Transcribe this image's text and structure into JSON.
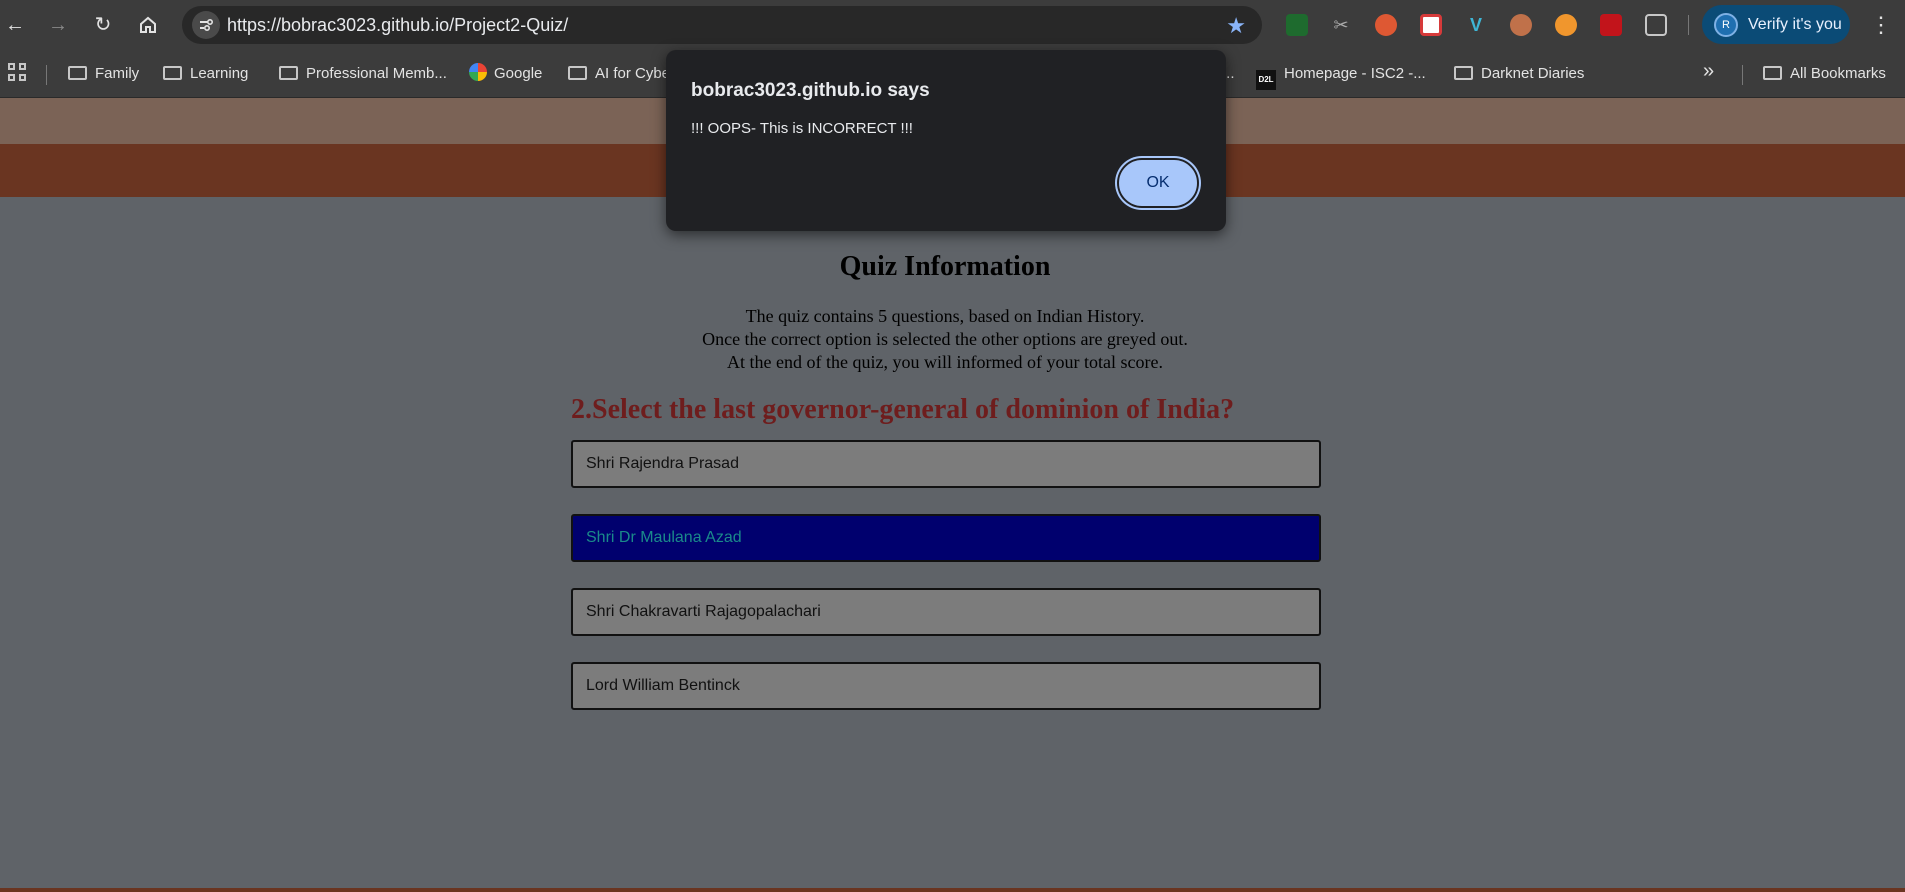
{
  "browser": {
    "url": "https://bobrac3023.github.io/Project2-Quiz/",
    "profile_button": "Verify it's you",
    "profile_initial": "R"
  },
  "bookmarks": {
    "items": [
      {
        "label": "Family",
        "icon": "folder-icon"
      },
      {
        "label": "Learning",
        "icon": "folder-icon"
      },
      {
        "label": "Professional Memb...",
        "icon": "folder-icon"
      },
      {
        "label": "Google",
        "icon": "google-icon"
      },
      {
        "label": "AI for Cybe",
        "icon": "folder-icon"
      },
      {
        "label": "...",
        "icon": ""
      },
      {
        "label": "Homepage - ISC2 -...",
        "icon": "d2l-icon"
      },
      {
        "label": "Darknet Diaries",
        "icon": "folder-icon"
      }
    ],
    "d2l_label": "D2L",
    "all_bookmarks": "All Bookmarks"
  },
  "dialog": {
    "title": "bobrac3023.github.io says",
    "message": "!!! OOPS- This is INCORRECT !!!",
    "ok_label": "OK"
  },
  "quiz": {
    "title": "Quiz Information",
    "description": [
      "The quiz contains 5 questions, based on Indian History.",
      "Once the correct option is selected the other options are greyed out.",
      "At the end of the quiz, you will informed of your total score."
    ],
    "question": "2.Select the last governor-general of dominion of India?",
    "options": [
      {
        "label": "Shri Rajendra Prasad",
        "selected": false
      },
      {
        "label": "Shri Dr Maulana Azad",
        "selected": true
      },
      {
        "label": "Shri Chakravarti Rajagopalachari",
        "selected": false
      },
      {
        "label": "Lord William Bentinck",
        "selected": false
      }
    ]
  },
  "colors": {
    "header_band_light": "#7b6356",
    "header_band_dark": "#6a3521",
    "page_background": "#5f6368",
    "question_color": "#6e1d1d",
    "selected_option_bg": "#00006e",
    "dialog_ok_bg": "#a8c7fa"
  }
}
